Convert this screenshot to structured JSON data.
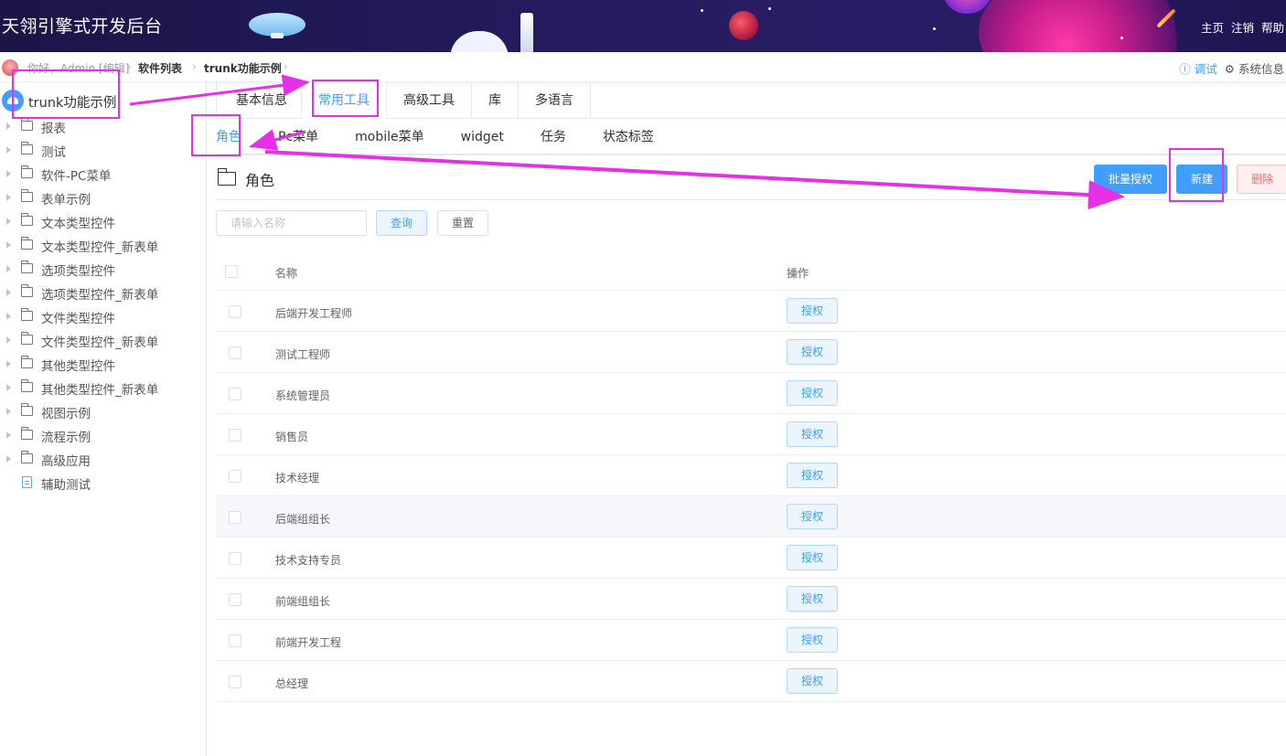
{
  "banner": {
    "title": "天翎引擎式开发后台",
    "nav": [
      "主页",
      "注销",
      "帮助"
    ]
  },
  "breadcrumb": {
    "greeting": "你好，Admin [编辑]",
    "items": [
      "软件列表",
      "trunk功能示例"
    ],
    "debug_label": "调试",
    "sysinfo_label": "系统信息"
  },
  "sidebar": {
    "app_name": "trunk功能示例",
    "items": [
      {
        "label": "报表",
        "type": "folder"
      },
      {
        "label": "测试",
        "type": "folder"
      },
      {
        "label": "软件-PC菜单",
        "type": "folder"
      },
      {
        "label": "表单示例",
        "type": "folder"
      },
      {
        "label": "文本类型控件",
        "type": "folder"
      },
      {
        "label": "文本类型控件_新表单",
        "type": "folder"
      },
      {
        "label": "选项类型控件",
        "type": "folder"
      },
      {
        "label": "选项类型控件_新表单",
        "type": "folder"
      },
      {
        "label": "文件类型控件",
        "type": "folder"
      },
      {
        "label": "文件类型控件_新表单",
        "type": "folder"
      },
      {
        "label": "其他类型控件",
        "type": "folder"
      },
      {
        "label": "其他类型控件_新表单",
        "type": "folder"
      },
      {
        "label": "视图示例",
        "type": "folder"
      },
      {
        "label": "流程示例",
        "type": "folder"
      },
      {
        "label": "高级应用",
        "type": "folder"
      },
      {
        "label": "辅助测试",
        "type": "document"
      }
    ]
  },
  "tabs_primary": [
    {
      "label": "基本信息",
      "active": false
    },
    {
      "label": "常用工具",
      "active": true
    },
    {
      "label": "高级工具",
      "active": false
    },
    {
      "label": "库",
      "active": false
    },
    {
      "label": "多语言",
      "active": false
    }
  ],
  "tabs_secondary": [
    {
      "label": "角色",
      "active": true
    },
    {
      "label": "Pc菜单",
      "active": false
    },
    {
      "label": "mobile菜单",
      "active": false
    },
    {
      "label": "widget",
      "active": false
    },
    {
      "label": "任务",
      "active": false
    },
    {
      "label": "状态标签",
      "active": false
    }
  ],
  "section": {
    "title": "角色",
    "batch_grant": "批量授权",
    "new": "新建",
    "delete": "删除"
  },
  "search": {
    "placeholder": "请输入名称",
    "query": "查询",
    "reset": "重置"
  },
  "table": {
    "columns": {
      "name": "名称",
      "operation": "操作"
    },
    "grant_label": "授权",
    "rows": [
      {
        "name": "后端开发工程师"
      },
      {
        "name": "测试工程师"
      },
      {
        "name": "系统管理员"
      },
      {
        "name": "销售员"
      },
      {
        "name": "技术经理"
      },
      {
        "name": "后端组组长",
        "highlighted": true
      },
      {
        "name": "技术支持专员"
      },
      {
        "name": "前端组组长"
      },
      {
        "name": "前端开发工程"
      },
      {
        "name": "总经理"
      }
    ]
  },
  "colors": {
    "accent": "#409eff",
    "annotation": "#e62fe6",
    "banner_bg": "#1c1547"
  }
}
